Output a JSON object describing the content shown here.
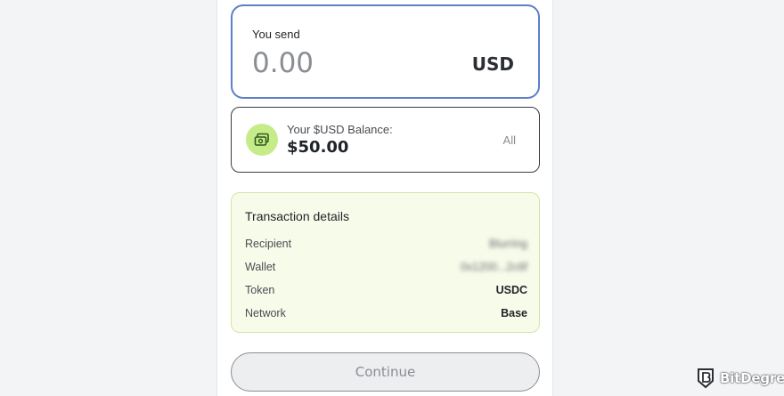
{
  "send": {
    "label": "You send",
    "amount_placeholder": "0.00",
    "currency": "USD"
  },
  "balance": {
    "label": "Your $USD Balance:",
    "value": "$50.00",
    "all_label": "All",
    "icon": "wallet-icon",
    "badge_color": "#c5ec88"
  },
  "details": {
    "title": "Transaction details",
    "rows": [
      {
        "label": "Recipient",
        "value": "Blurring"
      },
      {
        "label": "Wallet",
        "value": "0x1200...2c6f"
      },
      {
        "label": "Token",
        "value": "USDC"
      },
      {
        "label": "Network",
        "value": "Base"
      }
    ]
  },
  "continue_label": "Continue",
  "brand": {
    "name": "BitDegree",
    "icon": "bitdegree-shield-icon"
  },
  "colors": {
    "accent_border": "#5b7fc9",
    "details_bg": "#f7fbea",
    "details_border": "#d6e3a4"
  }
}
